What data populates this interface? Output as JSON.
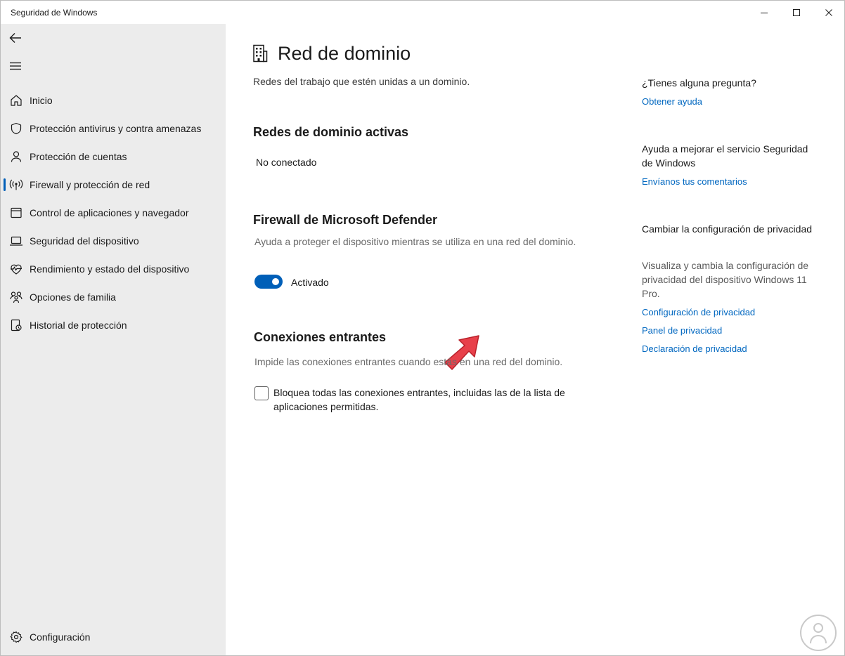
{
  "window": {
    "title": "Seguridad de Windows"
  },
  "sidebar": {
    "items": [
      {
        "label": "Inicio",
        "icon": "home-icon"
      },
      {
        "label": "Protección antivirus y contra amenazas",
        "icon": "shield-icon"
      },
      {
        "label": "Protección de cuentas",
        "icon": "person-icon"
      },
      {
        "label": "Firewall y protección de red",
        "icon": "antenna-icon",
        "selected": true
      },
      {
        "label": "Control de aplicaciones y navegador",
        "icon": "app-window-icon"
      },
      {
        "label": "Seguridad del dispositivo",
        "icon": "laptop-icon"
      },
      {
        "label": "Rendimiento y estado del dispositivo",
        "icon": "heart-pulse-icon"
      },
      {
        "label": "Opciones de familia",
        "icon": "family-icon"
      },
      {
        "label": "Historial de protección",
        "icon": "history-icon"
      }
    ],
    "settings_label": "Configuración"
  },
  "main": {
    "title": "Red de dominio",
    "description": "Redes del trabajo que estén unidas a un dominio.",
    "active_networks": {
      "heading": "Redes de dominio activas",
      "status": "No conectado"
    },
    "firewall": {
      "heading": "Firewall de Microsoft Defender",
      "description": "Ayuda a proteger el dispositivo mientras se utiliza en una red del dominio.",
      "toggle_label": "Activado",
      "toggle_on": true
    },
    "incoming": {
      "heading": "Conexiones entrantes",
      "description": "Impide las conexiones entrantes cuando estás en una red del dominio.",
      "checkbox_label": "Bloquea todas las conexiones entrantes, incluidas las de la lista de aplicaciones permitidas.",
      "checked": false
    }
  },
  "help": {
    "question": "¿Tienes alguna pregunta?",
    "get_help": "Obtener ayuda",
    "improve": "Ayuda a mejorar el servicio Seguridad de Windows",
    "feedback": "Envíanos tus comentarios",
    "privacy_heading": "Cambiar la configuración de privacidad",
    "privacy_desc": "Visualiza y cambia la configuración de privacidad del dispositivo Windows 11 Pro.",
    "privacy_settings": "Configuración de privacidad",
    "privacy_dashboard": "Panel de privacidad",
    "privacy_statement": "Declaración de privacidad"
  },
  "colors": {
    "accent": "#005fb8",
    "link": "#0067c0",
    "sidebar_bg": "#ececec",
    "annotation_arrow": "#e8404a"
  }
}
